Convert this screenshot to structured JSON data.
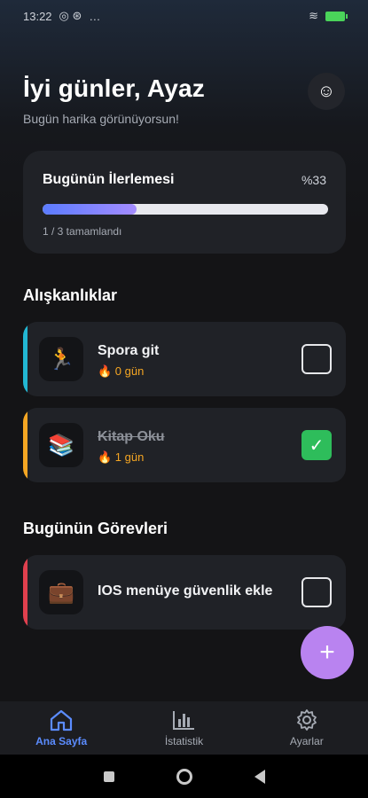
{
  "status_bar": {
    "time": "13:22",
    "extra": "…"
  },
  "header": {
    "greeting": "İyi günler, Ayaz",
    "subtitle": "Bugün harika görünüyorsun!",
    "mood_icon": "☺"
  },
  "progress": {
    "title": "Bugünün İlerlemesi",
    "percent_text": "%33",
    "fraction": 0.33,
    "subtitle": "1 / 3 tamamlandı"
  },
  "habits": {
    "section_title": "Alışkanlıklar",
    "items": [
      {
        "title": "Spora git",
        "streak": "🔥 0 gün",
        "icon": "🏃",
        "accent": "#22b7d3",
        "done": false
      },
      {
        "title": "Kitap Oku",
        "streak": "🔥 1 gün",
        "icon": "📚",
        "accent": "#f5a623",
        "done": true
      }
    ]
  },
  "tasks": {
    "section_title": "Bugünün Görevleri",
    "items": [
      {
        "title": "IOS menüye güvenlik ekle",
        "icon": "💼",
        "accent": "#e0404e",
        "done": false
      }
    ]
  },
  "fab": {
    "label": "+"
  },
  "nav": {
    "home": "Ana Sayfa",
    "stats": "İstatistik",
    "settings": "Ayarlar",
    "active": "home"
  },
  "colors": {
    "accent": "#5b8cff",
    "fab": "#b983f0",
    "check": "#2ebd5b"
  }
}
